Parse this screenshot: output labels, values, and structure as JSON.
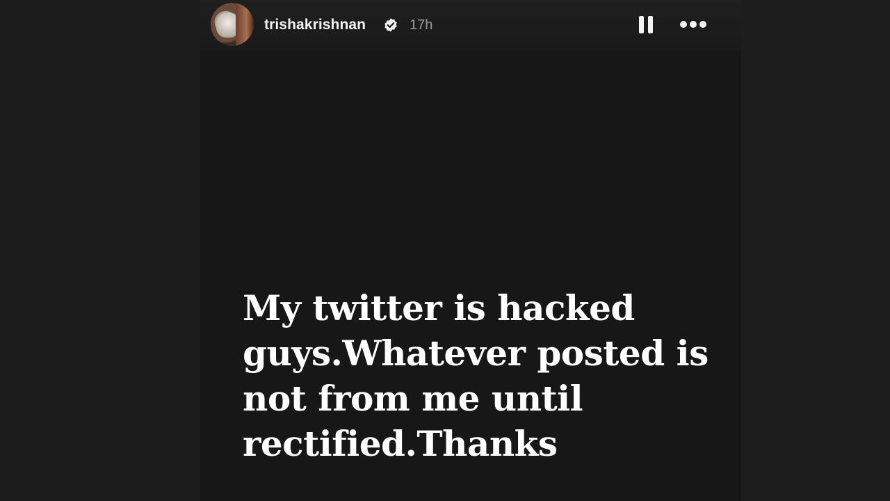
{
  "header": {
    "username": "trishakrishnan",
    "verified_icon": "verified-badge-icon",
    "timestamp": "17h",
    "pause_icon": "pause-icon",
    "more_icon": "more-options-icon"
  },
  "story": {
    "text": "My twitter is hacked guys.Whatever posted is not from me until rectified.Thanks",
    "background_color": "#171717",
    "text_color": "#ffffff"
  }
}
